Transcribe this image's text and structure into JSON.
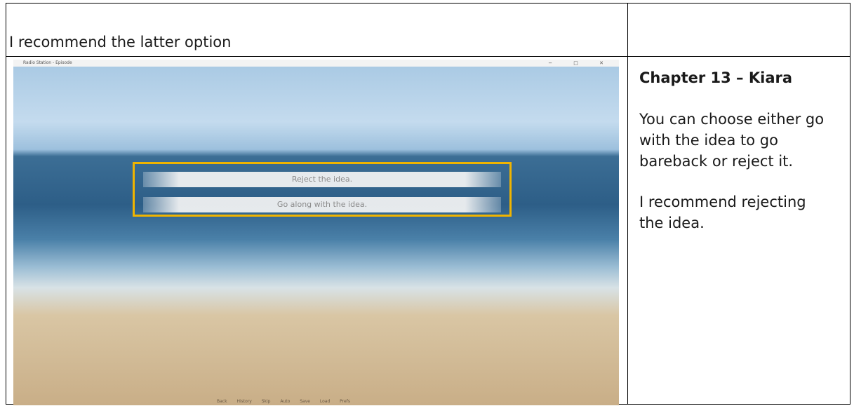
{
  "caption": "I recommend the latter option",
  "notes": {
    "chapter": "Chapter 13 – Kiara",
    "paragraph_1": "You can choose either go with the idea to go bareback or reject it.",
    "paragraph_2": "I recommend rejecting the idea."
  },
  "game": {
    "window_title": "Radio Station - Episode",
    "window_controls": "− □ ✕",
    "choices": [
      {
        "label": "Reject the idea."
      },
      {
        "label": "Go along with the idea."
      }
    ],
    "quick_menu": "Back History Skip Auto Save Load Prefs"
  },
  "colors": {
    "highlight": "#f0b400",
    "border": "#000000"
  }
}
